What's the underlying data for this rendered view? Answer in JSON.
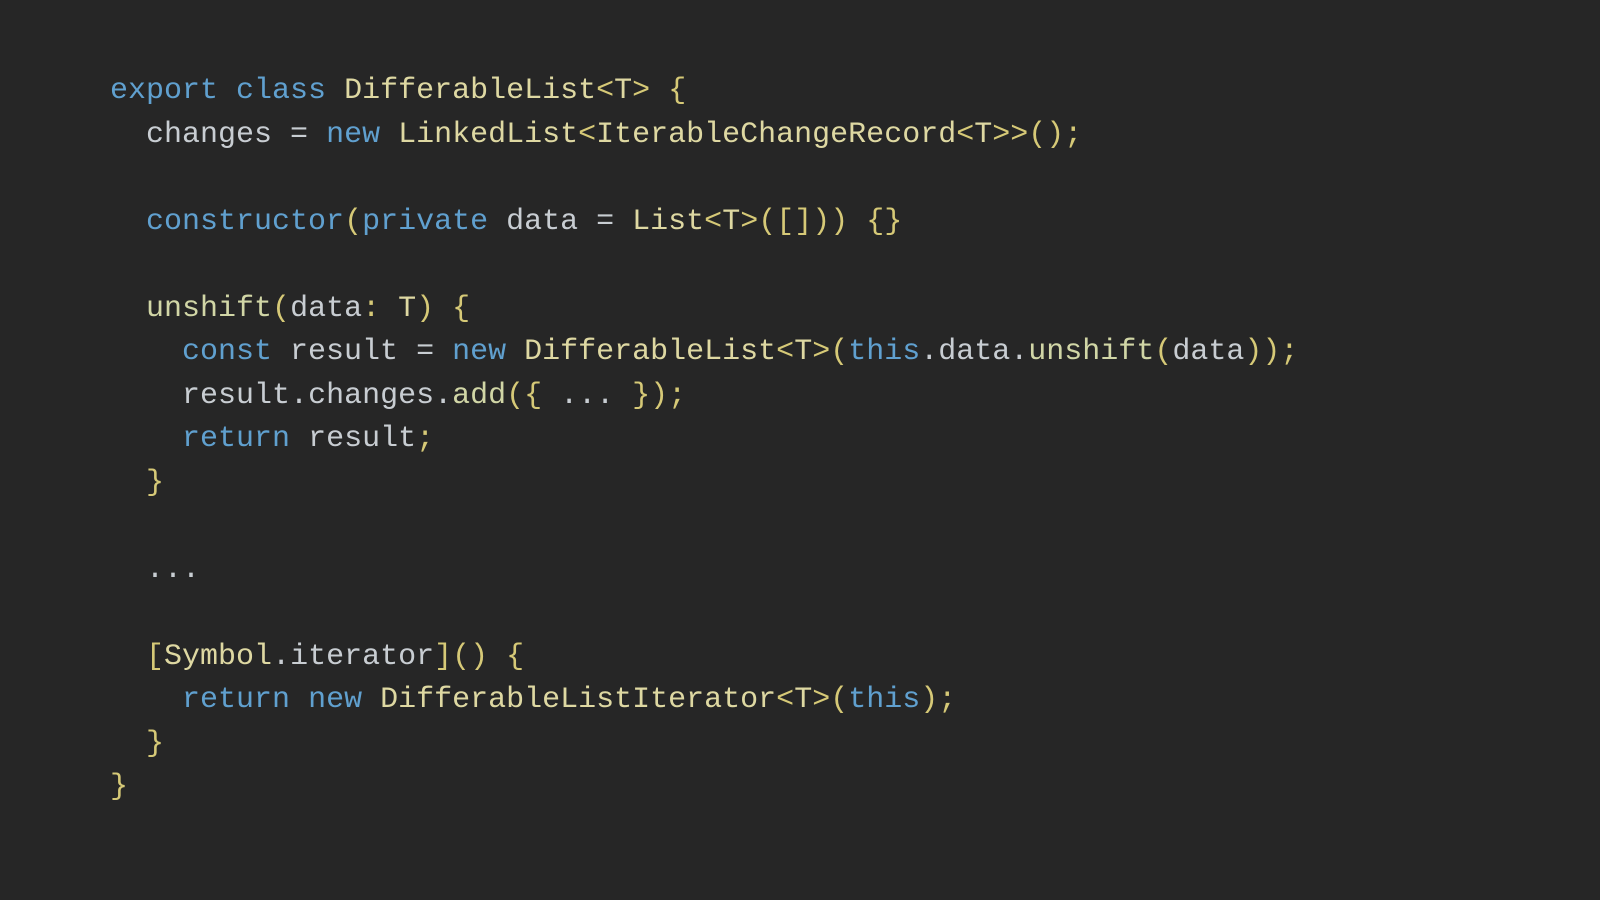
{
  "colors": {
    "background": "#262626",
    "keyword": "#60a0cf",
    "type": "#ded8a2",
    "identifier": "#c8cdd2",
    "function": "#d1d6a6",
    "punctuation": "#d6c977"
  },
  "code": {
    "language": "typescript",
    "tokens": [
      [
        {
          "t": "export",
          "c": "kw"
        },
        {
          "t": " "
        },
        {
          "t": "class",
          "c": "kw"
        },
        {
          "t": " "
        },
        {
          "t": "DifferableList",
          "c": "type"
        },
        {
          "t": "<",
          "c": "punc"
        },
        {
          "t": "T",
          "c": "type"
        },
        {
          "t": ">",
          "c": "punc"
        },
        {
          "t": " "
        },
        {
          "t": "{",
          "c": "punc"
        }
      ],
      [
        {
          "t": "  "
        },
        {
          "t": "changes",
          "c": "id"
        },
        {
          "t": " = ",
          "c": "id"
        },
        {
          "t": "new",
          "c": "kw"
        },
        {
          "t": " "
        },
        {
          "t": "LinkedList",
          "c": "type"
        },
        {
          "t": "<",
          "c": "punc"
        },
        {
          "t": "IterableChangeRecord",
          "c": "type"
        },
        {
          "t": "<",
          "c": "punc"
        },
        {
          "t": "T",
          "c": "type"
        },
        {
          "t": ">>",
          "c": "punc"
        },
        {
          "t": "();",
          "c": "punc"
        }
      ],
      [],
      [
        {
          "t": "  "
        },
        {
          "t": "constructor",
          "c": "kw"
        },
        {
          "t": "(",
          "c": "punc"
        },
        {
          "t": "private",
          "c": "kw"
        },
        {
          "t": " "
        },
        {
          "t": "data",
          "c": "id"
        },
        {
          "t": " = ",
          "c": "id"
        },
        {
          "t": "List",
          "c": "type"
        },
        {
          "t": "<",
          "c": "punc"
        },
        {
          "t": "T",
          "c": "type"
        },
        {
          "t": ">",
          "c": "punc"
        },
        {
          "t": "([]))",
          "c": "punc"
        },
        {
          "t": " "
        },
        {
          "t": "{}",
          "c": "punc"
        }
      ],
      [],
      [
        {
          "t": "  "
        },
        {
          "t": "unshift",
          "c": "fn"
        },
        {
          "t": "(",
          "c": "punc"
        },
        {
          "t": "data",
          "c": "id"
        },
        {
          "t": ": ",
          "c": "punc"
        },
        {
          "t": "T",
          "c": "type"
        },
        {
          "t": ")",
          "c": "punc"
        },
        {
          "t": " "
        },
        {
          "t": "{",
          "c": "punc"
        }
      ],
      [
        {
          "t": "    "
        },
        {
          "t": "const",
          "c": "kw"
        },
        {
          "t": " "
        },
        {
          "t": "result",
          "c": "id"
        },
        {
          "t": " = ",
          "c": "id"
        },
        {
          "t": "new",
          "c": "kw"
        },
        {
          "t": " "
        },
        {
          "t": "DifferableList",
          "c": "type"
        },
        {
          "t": "<",
          "c": "punc"
        },
        {
          "t": "T",
          "c": "type"
        },
        {
          "t": ">",
          "c": "punc"
        },
        {
          "t": "(",
          "c": "punc"
        },
        {
          "t": "this",
          "c": "kw"
        },
        {
          "t": ".",
          "c": "id"
        },
        {
          "t": "data",
          "c": "id"
        },
        {
          "t": ".",
          "c": "id"
        },
        {
          "t": "unshift",
          "c": "fn"
        },
        {
          "t": "(",
          "c": "punc"
        },
        {
          "t": "data",
          "c": "id"
        },
        {
          "t": "));",
          "c": "punc"
        }
      ],
      [
        {
          "t": "    "
        },
        {
          "t": "result",
          "c": "id"
        },
        {
          "t": ".",
          "c": "id"
        },
        {
          "t": "changes",
          "c": "id"
        },
        {
          "t": ".",
          "c": "id"
        },
        {
          "t": "add",
          "c": "fn"
        },
        {
          "t": "({",
          "c": "punc"
        },
        {
          "t": " ... ",
          "c": "id"
        },
        {
          "t": "});",
          "c": "punc"
        }
      ],
      [
        {
          "t": "    "
        },
        {
          "t": "return",
          "c": "kw"
        },
        {
          "t": " "
        },
        {
          "t": "result",
          "c": "id"
        },
        {
          "t": ";",
          "c": "punc"
        }
      ],
      [
        {
          "t": "  "
        },
        {
          "t": "}",
          "c": "punc"
        }
      ],
      [],
      [
        {
          "t": "  "
        },
        {
          "t": "...",
          "c": "id"
        }
      ],
      [],
      [
        {
          "t": "  "
        },
        {
          "t": "[",
          "c": "punc"
        },
        {
          "t": "Symbol",
          "c": "type"
        },
        {
          "t": ".",
          "c": "id"
        },
        {
          "t": "iterator",
          "c": "id"
        },
        {
          "t": "]()",
          "c": "punc"
        },
        {
          "t": " "
        },
        {
          "t": "{",
          "c": "punc"
        }
      ],
      [
        {
          "t": "    "
        },
        {
          "t": "return",
          "c": "kw"
        },
        {
          "t": " "
        },
        {
          "t": "new",
          "c": "kw"
        },
        {
          "t": " "
        },
        {
          "t": "DifferableListIterator",
          "c": "type"
        },
        {
          "t": "<",
          "c": "punc"
        },
        {
          "t": "T",
          "c": "type"
        },
        {
          "t": ">",
          "c": "punc"
        },
        {
          "t": "(",
          "c": "punc"
        },
        {
          "t": "this",
          "c": "kw"
        },
        {
          "t": ");",
          "c": "punc"
        }
      ],
      [
        {
          "t": "  "
        },
        {
          "t": "}",
          "c": "punc"
        }
      ],
      [
        {
          "t": "}",
          "c": "punc"
        }
      ]
    ]
  }
}
